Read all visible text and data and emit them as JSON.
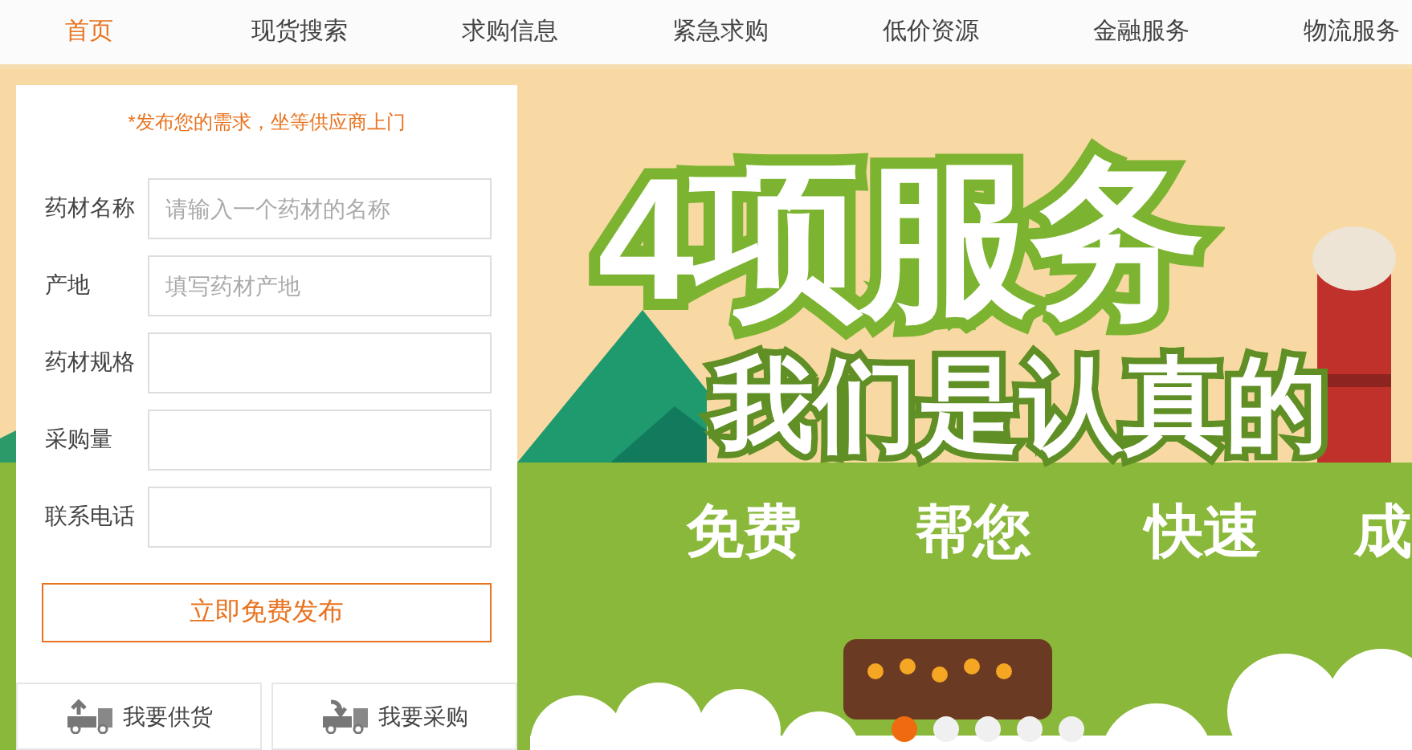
{
  "nav": [
    {
      "label": "首页",
      "selected": true
    },
    {
      "label": "现货搜索",
      "selected": false
    },
    {
      "label": "求购信息",
      "selected": false
    },
    {
      "label": "紧急求购",
      "selected": false
    },
    {
      "label": "低价资源",
      "selected": false
    },
    {
      "label": "金融服务",
      "selected": false
    },
    {
      "label": "物流服务",
      "selected": false
    }
  ],
  "banner": {
    "headline": "4项服务",
    "subheadline": "我们是认真的",
    "tags": [
      "免费",
      "帮您",
      "快速",
      "成"
    ],
    "slides": [
      {
        "selected": true
      },
      {
        "selected": false
      },
      {
        "selected": false
      },
      {
        "selected": false
      },
      {
        "selected": false
      }
    ]
  },
  "form": {
    "note": "*发布您的需求，坐等供应商上门",
    "fields": [
      {
        "label": "药材名称",
        "placeholder": "请输入一个药材的名称"
      },
      {
        "label": "产地",
        "placeholder": "填写药材产地"
      },
      {
        "label": "药材规格"
      },
      {
        "label": "采购量"
      },
      {
        "label": "联系电话"
      }
    ],
    "submit": "立即免费发布",
    "actions": [
      {
        "kind": "supply",
        "label": "我要供货"
      },
      {
        "kind": "purchase",
        "label": "我要采购"
      }
    ]
  }
}
